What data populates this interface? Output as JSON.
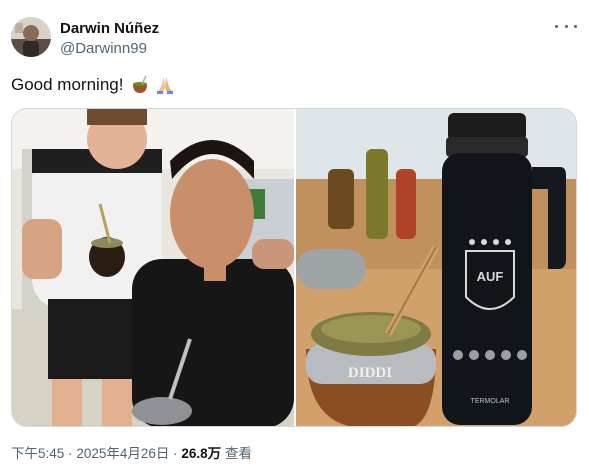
{
  "author": {
    "display_name": "Darwin Núñez",
    "handle": "@Darwinn99"
  },
  "more_menu_icon": "more-dots-icon",
  "tweet": {
    "text": "Good morning!",
    "emojis": [
      "mate-icon",
      "folded-hands-icon"
    ]
  },
  "media": {
    "count": 2,
    "photos": [
      {
        "subject": "selfie-two-players-with-mate"
      },
      {
        "subject": "mate-gourd-and-uruguay-thermos"
      }
    ],
    "gourd_engraving": "DIDDI",
    "thermos_crest_text": "AUF",
    "thermos_brand": "TERMOLAR"
  },
  "meta": {
    "time": "下午5:45",
    "separator": "·",
    "date": "2025年4月26日",
    "views_count": "26.8万",
    "views_label": "查看"
  },
  "colors": {
    "text_primary": "#0f1419",
    "text_secondary": "#536471",
    "border": "#cfd9de"
  }
}
